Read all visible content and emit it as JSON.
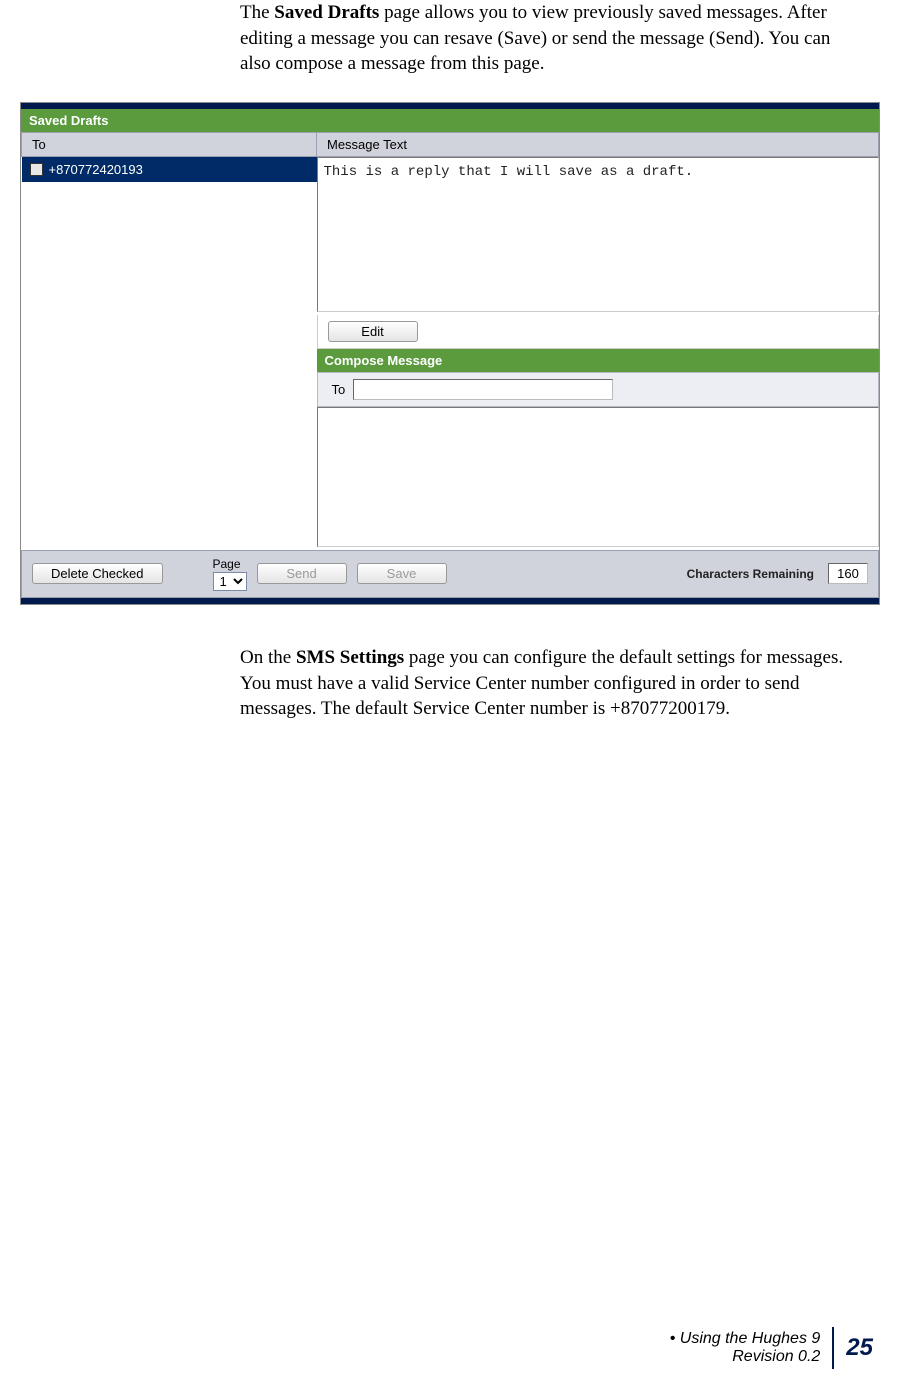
{
  "paragraph1": {
    "t1": "The ",
    "b1": "Saved Drafts",
    "t2": " page allows you to view previously saved messages. After editing a message you can resave (Save) or send the message (Send).  You can also compose a message from this page."
  },
  "ui": {
    "title": "Saved Drafts",
    "headers": {
      "to": "To",
      "msg": "Message Text"
    },
    "row": {
      "phone": "+870772420193",
      "text": "This is a reply that I will save as a draft."
    },
    "buttons": {
      "edit": "Edit",
      "delete": "Delete Checked",
      "send": "Send",
      "save": "Save"
    },
    "compose": {
      "title": "Compose Message",
      "to_label": "To"
    },
    "page_label": "Page",
    "page_value": "1",
    "chars_label": "Characters Remaining",
    "chars_value": "160"
  },
  "paragraph2": {
    "t1": "On the ",
    "b1": "SMS Settings",
    "t2": " page you can configure the default settings for messages. You must have a valid Service Center number configured in order to send messages.  The default Service Center number is +87077200179."
  },
  "footer": {
    "line1": " Using the Hughes 9",
    "line2": "Revision 0.2",
    "page": "25"
  }
}
